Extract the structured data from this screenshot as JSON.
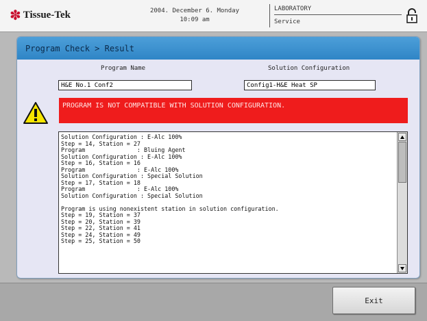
{
  "brand": {
    "name": "Tissue-Tek"
  },
  "datetime": {
    "date": "2004. December 6. Monday",
    "time": "10:09 am"
  },
  "department": {
    "lab": "LABORATORY",
    "mode": "Service"
  },
  "header": {
    "title": "Program Check > Result"
  },
  "program": {
    "label": "Program Name",
    "value": "H&E No.1 Conf2"
  },
  "solution": {
    "label": "Solution Configuration",
    "value": "Config1-H&E Heat SP"
  },
  "error": {
    "message": "PROGRAM IS NOT COMPATIBLE WITH SOLUTION CONFIGURATION."
  },
  "log": {
    "lines": [
      "Solution Configuration : E-Alc 100%",
      "Step = 14, Station = 27",
      "Program               : Bluing Agent",
      "Solution Configuration : E-Alc 100%",
      "Step = 16, Station = 16",
      "Program               : E-Alc 100%",
      "Solution Configuration : Special Solution",
      "Step = 17, Station = 18",
      "Program               : E-Alc 100%",
      "Solution Configuration : Special Solution",
      "",
      "Program is using nonexistent station in solution configuration.",
      "Step = 19, Station = 37",
      "Step = 20, Station = 39",
      "Step = 22, Station = 41",
      "Step = 24, Station = 49",
      "Step = 25, Station = 50"
    ]
  },
  "footer": {
    "exit_label": "Exit"
  },
  "colors": {
    "error": "#ef1c1c",
    "header": "#3a8fd0",
    "panel": "#e6e6f4"
  },
  "icons": {
    "logo": "flower-logo-icon",
    "lock": "lock-icon",
    "warning": "warning-icon"
  }
}
